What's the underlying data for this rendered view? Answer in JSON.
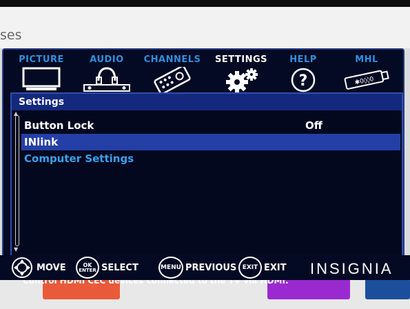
{
  "background": {
    "partial_text": "ses",
    "tile_colors": [
      "#e85a3a",
      "#9a2ad0",
      "#1b4f9c"
    ]
  },
  "tabs": [
    {
      "label": "PICTURE",
      "icon": "tv-icon"
    },
    {
      "label": "AUDIO",
      "icon": "headphones-icon"
    },
    {
      "label": "CHANNELS",
      "icon": "remote-control-icon"
    },
    {
      "label": "SETTINGS",
      "icon": "gear-icon",
      "active": true
    },
    {
      "label": "HELP",
      "icon": "question-mark-icon"
    },
    {
      "label": "MHL",
      "icon": "mhl-usb-icon"
    }
  ],
  "panel": {
    "title": "Settings",
    "items": [
      {
        "label": "Button Lock",
        "value": "Off",
        "state": "normal"
      },
      {
        "label": "INlink",
        "value": "",
        "state": "selected"
      },
      {
        "label": "Computer Settings",
        "value": "",
        "state": "link"
      }
    ],
    "help_text": "Control HDMI CEC devices connected to the TV via HDMI."
  },
  "legend": {
    "move": "MOVE",
    "ok_button": "OK",
    "enter_button": "ENTER",
    "select": "SELECT",
    "menu_button": "MENU",
    "previous": "PREVIOUS",
    "exit_button": "EXIT",
    "exit": "EXIT"
  },
  "brand": "INSIGNIA",
  "colors": {
    "accent": "#2f8fe0",
    "selected_row": "#243fa5",
    "panel_bg": "#040a23",
    "title_bar": "#14297d"
  }
}
